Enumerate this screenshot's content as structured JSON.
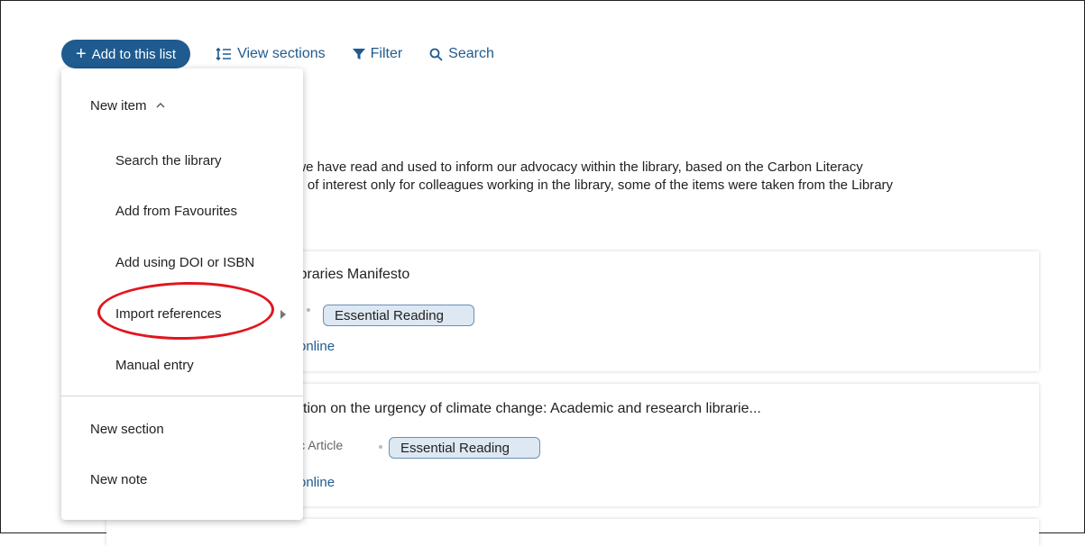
{
  "toolbar": {
    "add_label": "Add to this list",
    "view_sections_label": "View sections",
    "filter_label": "Filter",
    "search_label": "Search"
  },
  "description": {
    "line1": "t we have read and used to inform our advocacy within the library, based on the Carbon Literacy",
    "line2": "oe of interest only for colleagues working in the library, some of the items were taken from the Library"
  },
  "items": [
    {
      "title": "ibraries Manifesto",
      "meta": "",
      "badge": "Essential Reading",
      "link": "online"
    },
    {
      "title": "ction on the urgency of climate change: Academic and research librarie...",
      "meta": "ic Article",
      "badge": "Essential Reading",
      "link": "online"
    }
  ],
  "menu": {
    "new_item_label": "New item",
    "sub_items": [
      "Search the library",
      "Add from Favourites",
      "Add using DOI or ISBN",
      "Import references",
      "Manual entry"
    ],
    "new_section_label": "New section",
    "new_note_label": "New note"
  },
  "colors": {
    "primary": "#1f5b8f",
    "annotation": "#e0161e",
    "badge_bg": "#dde8f3"
  }
}
